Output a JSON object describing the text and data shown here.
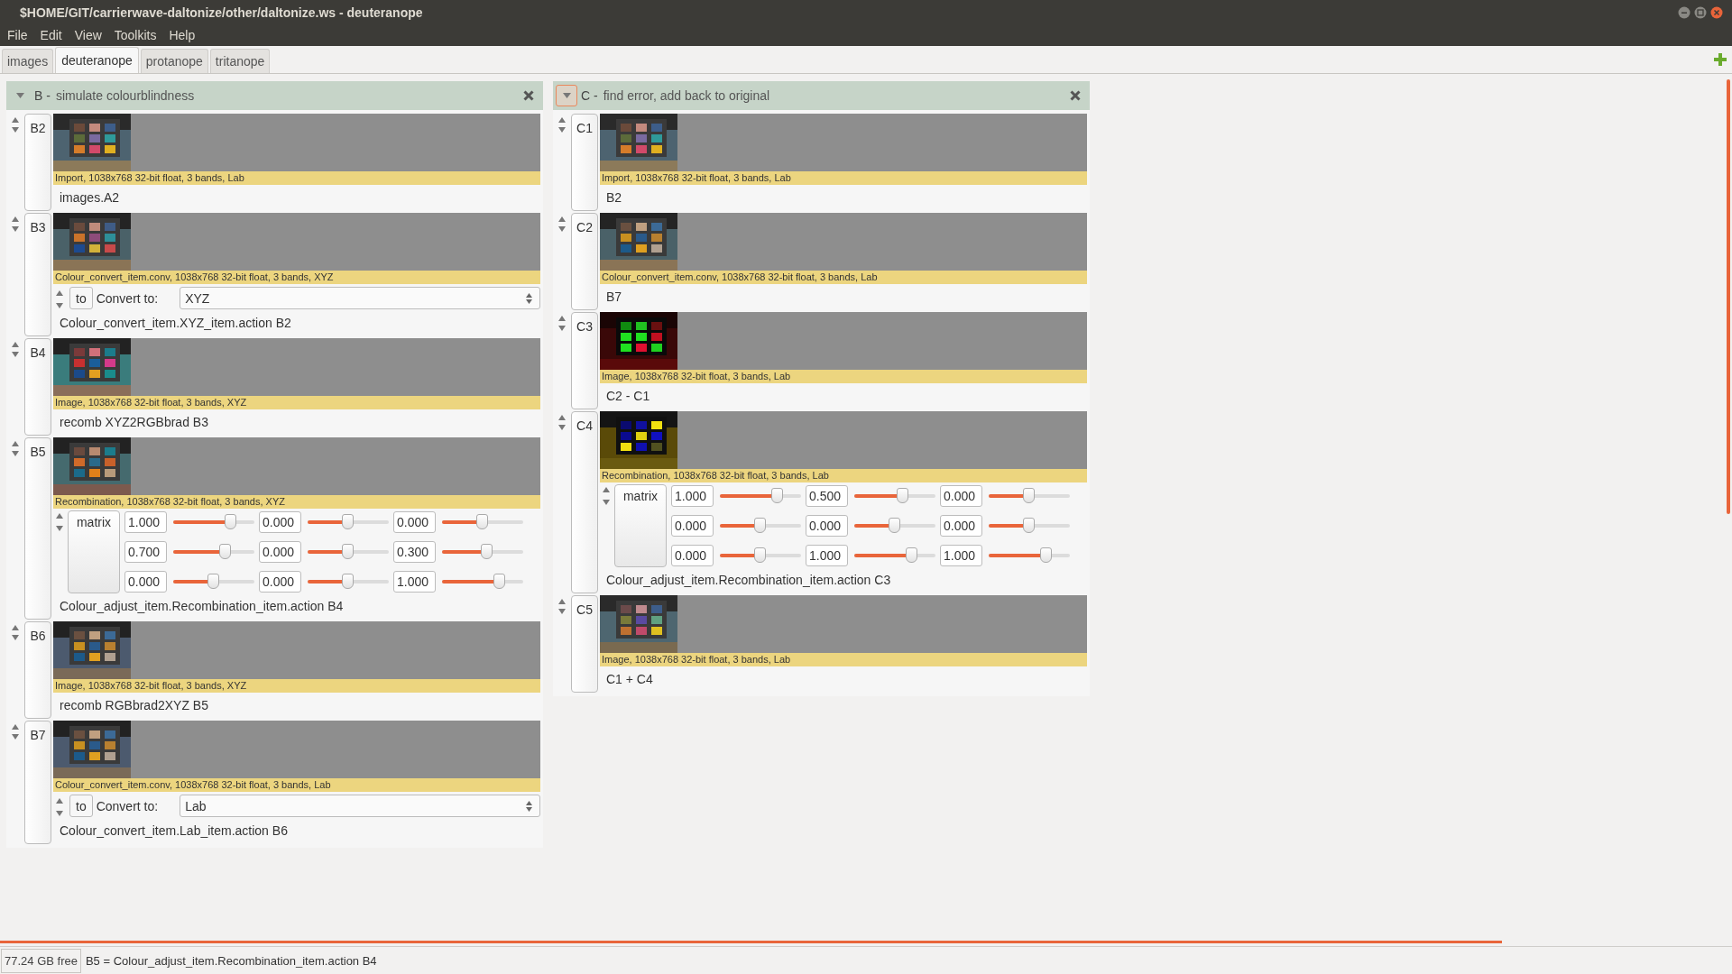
{
  "window": {
    "title": "$HOME/GIT/carrierwave-daltonize/other/daltonize.ws - deuteranope"
  },
  "menu": [
    "File",
    "Edit",
    "View",
    "Toolkits",
    "Help"
  ],
  "tabs": [
    {
      "label": "images",
      "selected": false
    },
    {
      "label": "deuteranope",
      "selected": true
    },
    {
      "label": "protanope",
      "selected": false
    },
    {
      "label": "tritanope",
      "selected": false
    }
  ],
  "columns": [
    {
      "letter": "B -",
      "title": "simulate colourblindness",
      "toggle_focused": false,
      "rows": [
        {
          "id": "B2",
          "caption": "Import, 1038x768 32-bit float, 3 bands, Lab",
          "label": "images.A2"
        },
        {
          "id": "B3",
          "kind": "convert",
          "caption": "Colour_convert_item.conv, 1038x768 32-bit float, 3 bands, XYZ",
          "button": "to",
          "field_label": "Convert to:",
          "value": "XYZ",
          "label": "Colour_convert_item.XYZ_item.action B2"
        },
        {
          "id": "B4",
          "caption": "Image, 1038x768 32-bit float, 3 bands, XYZ",
          "label": "recomb XYZ2RGBbrad B3"
        },
        {
          "id": "B5",
          "kind": "matrix",
          "caption": "Recombination, 1038x768 32-bit float, 3 bands, XYZ",
          "button": "matrix",
          "cells": [
            [
              {
                "value": "1.000",
                "level": 0.71
              },
              {
                "value": "0.000",
                "level": 0.5
              },
              {
                "value": "0.000",
                "level": 0.5
              }
            ],
            [
              {
                "value": "0.700",
                "level": 0.65
              },
              {
                "value": "0.000",
                "level": 0.5
              },
              {
                "value": "0.300",
                "level": 0.56
              }
            ],
            [
              {
                "value": "0.000",
                "level": 0.5
              },
              {
                "value": "0.000",
                "level": 0.5
              },
              {
                "value": "1.000",
                "level": 0.71
              }
            ]
          ],
          "label": "Colour_adjust_item.Recombination_item.action B4"
        },
        {
          "id": "B6",
          "caption": "Image, 1038x768 32-bit float, 3 bands, XYZ",
          "label": "recomb RGBbrad2XYZ B5"
        },
        {
          "id": "B7",
          "kind": "convert",
          "caption": "Colour_convert_item.conv, 1038x768 32-bit float, 3 bands, Lab",
          "button": "to",
          "field_label": "Convert to:",
          "value": "Lab",
          "label": "Colour_convert_item.Lab_item.action B6"
        }
      ]
    },
    {
      "letter": "C -",
      "title": "find error, add back to original",
      "toggle_focused": true,
      "rows": [
        {
          "id": "C1",
          "caption": "Import, 1038x768 32-bit float, 3 bands, Lab",
          "label": "B2"
        },
        {
          "id": "C2",
          "caption": "Colour_convert_item.conv, 1038x768 32-bit float, 3 bands, Lab",
          "label": "B7"
        },
        {
          "id": "C3",
          "caption": "Image, 1038x768 32-bit float, 3 bands, Lab",
          "label": "C2 - C1"
        },
        {
          "id": "C4",
          "kind": "matrix",
          "caption": "Recombination, 1038x768 32-bit float, 3 bands, Lab",
          "button": "matrix",
          "cells": [
            [
              {
                "value": "1.000",
                "level": 0.71
              },
              {
                "value": "0.500",
                "level": 0.6
              },
              {
                "value": "0.000",
                "level": 0.5
              }
            ],
            [
              {
                "value": "0.000",
                "level": 0.5
              },
              {
                "value": "0.000",
                "level": 0.5
              },
              {
                "value": "0.000",
                "level": 0.5
              }
            ],
            [
              {
                "value": "0.000",
                "level": 0.5
              },
              {
                "value": "1.000",
                "level": 0.71
              },
              {
                "value": "1.000",
                "level": 0.71
              }
            ]
          ],
          "label": "Colour_adjust_item.Recombination_item.action C3"
        },
        {
          "id": "C5",
          "caption": "Image, 1038x768 32-bit float, 3 bands, Lab",
          "label": "C1 + C4"
        }
      ]
    }
  ],
  "status_bar": {
    "free_space": "77.24 GB free",
    "message": "B5 = Colour_adjust_item.Recombination_item.action B4"
  }
}
